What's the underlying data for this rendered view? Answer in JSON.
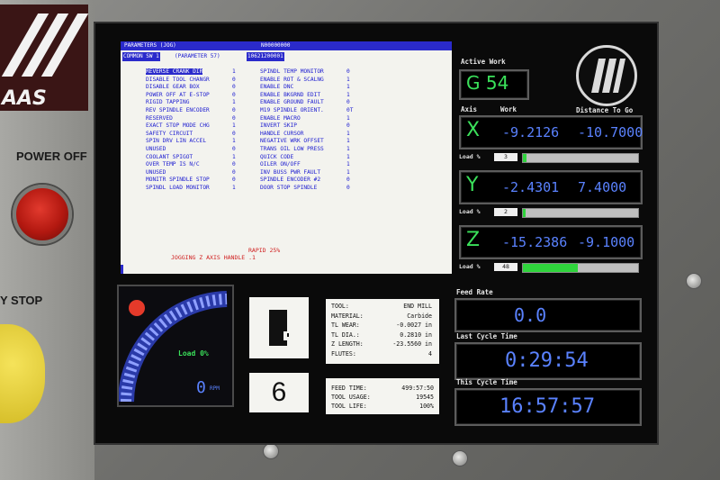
{
  "panel": {
    "logo_text": "AAS",
    "power_off_label": "POWER OFF",
    "estop_label": "Y STOP"
  },
  "parameters": {
    "title": "PARAMETERS (JOG)",
    "program": "N00000000",
    "group": "COMMON SW 1",
    "param_ref": "(PARAMETER 57)",
    "param_bits": "10621200001",
    "left_items": [
      {
        "label": "REVERSE CRANK DIR",
        "value": "1"
      },
      {
        "label": "DISABLE TOOL CHANGR",
        "value": "0"
      },
      {
        "label": "DISABLE GEAR BOX",
        "value": "0"
      },
      {
        "label": "POWER OFF AT E-STOP",
        "value": "0"
      },
      {
        "label": "RIGID TAPPING",
        "value": "1"
      },
      {
        "label": "REV SPINDLE ENCODER",
        "value": "0"
      },
      {
        "label": "RESERVED",
        "value": "0"
      },
      {
        "label": "EXACT STOP MODE CHG",
        "value": "1"
      },
      {
        "label": "SAFETY CIRCUIT",
        "value": "0"
      },
      {
        "label": "SPIN DRV LIN ACCEL",
        "value": "1"
      },
      {
        "label": "UNUSED",
        "value": "0"
      },
      {
        "label": "COOLANT SPIGOT",
        "value": "1"
      },
      {
        "label": "OVER TEMP IS N/C",
        "value": "0"
      },
      {
        "label": "UNUSED",
        "value": "0"
      },
      {
        "label": "MONITR SPINDLE STOP",
        "value": "0"
      },
      {
        "label": "SPINDL LOAD MONITOR",
        "value": "1"
      }
    ],
    "right_items": [
      {
        "label": "SPINDL TEMP MONITOR",
        "value": "0"
      },
      {
        "label": "ENABLE ROT & SCALNG",
        "value": "1"
      },
      {
        "label": "ENABLE DNC",
        "value": "1"
      },
      {
        "label": "ENABLE BKGRND EDIT",
        "value": "1"
      },
      {
        "label": "ENABLE GROUND FAULT",
        "value": "0"
      },
      {
        "label": "M19 SPINDLE ORIENT.",
        "value": "0T"
      },
      {
        "label": "ENABLE MACRO",
        "value": "1"
      },
      {
        "label": "INVERT SKIP",
        "value": "0"
      },
      {
        "label": "HANDLE CURSOR",
        "value": "1"
      },
      {
        "label": "NEGATIVE WRK OFFSET",
        "value": "1"
      },
      {
        "label": "TRANS OIL LOW PRESS",
        "value": "1"
      },
      {
        "label": "QUICK CODE",
        "value": "1"
      },
      {
        "label": "OILER ON/OFF",
        "value": "1"
      },
      {
        "label": "INV BUSS PWR FAULT",
        "value": "1"
      },
      {
        "label": "SPINDLE ENCODER #2",
        "value": "0"
      },
      {
        "label": "DOOR STOP SPINDLE",
        "value": "0"
      }
    ],
    "rapid_status": "RAPID 25%",
    "jog_status": "JOGGING Z  AXIS HANDLE .1"
  },
  "work": {
    "active_label": "Active Work",
    "active_value": "G 54",
    "axis_label": "Axis",
    "work_label": "Work",
    "dtg_label": "Distance To Go",
    "axes": [
      {
        "letter": "X",
        "work": "-9.2126",
        "dtg": "-10.7000",
        "load_label": "Load %",
        "load": "3",
        "load_pct": 3
      },
      {
        "letter": "Y",
        "work": "-2.4301",
        "dtg": "7.4000",
        "load_label": "Load %",
        "load": "2",
        "load_pct": 2
      },
      {
        "letter": "Z",
        "work": "-15.2386",
        "dtg": "-9.1000",
        "load_label": "Load %",
        "load": "48",
        "load_pct": 48
      }
    ]
  },
  "feed": {
    "label": "Feed Rate",
    "value": "0.0"
  },
  "cycle": {
    "last_label": "Last Cycle Time",
    "last_value": "0:29:54",
    "this_label": "This Cycle Time",
    "this_value": "16:57:57"
  },
  "spindle": {
    "load_label": "Load 0%",
    "rpm_value": "0",
    "rpm_unit": "RPM"
  },
  "tool": {
    "number": "6",
    "rows": [
      {
        "label": "TOOL:",
        "value": "END MILL"
      },
      {
        "label": "MATERIAL:",
        "value": "Carbide"
      },
      {
        "label": "TL WEAR:",
        "value": "-0.0027 in"
      },
      {
        "label": "TL DIA.:",
        "value": "0.2810 in"
      },
      {
        "label": "Z LENGTH:",
        "value": "-23.5560 in"
      },
      {
        "label": "FLUTES:",
        "value": "4"
      }
    ]
  },
  "usage": {
    "rows": [
      {
        "label": "FEED TIME:",
        "value": "499:57:50"
      },
      {
        "label": "TOOL USAGE:",
        "value": "19545"
      },
      {
        "label": "TOOL LIFE:",
        "value": "100%"
      }
    ]
  },
  "colors": {
    "lcd_blue": "#5a82ff",
    "axis_green": "#3ae05a",
    "param_blue": "#1b1bd0",
    "status_red": "#d02020"
  }
}
